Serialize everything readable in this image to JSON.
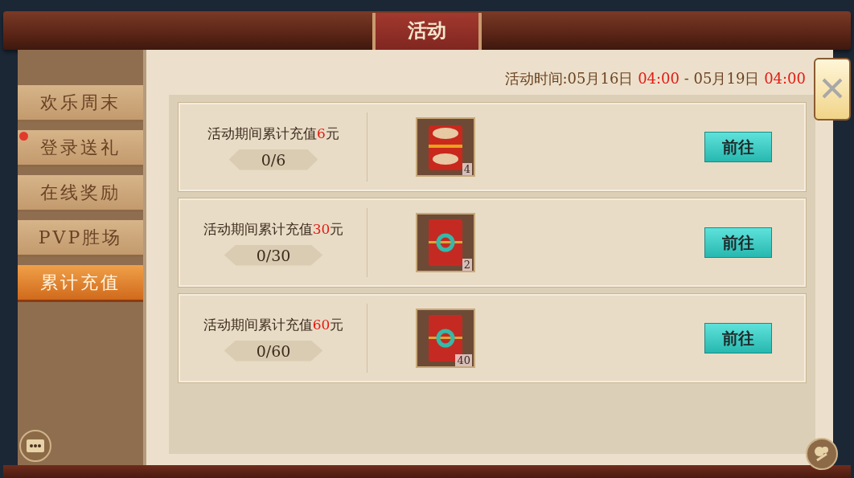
{
  "window": {
    "title": "活动"
  },
  "event_time": {
    "label": "活动时间:",
    "start_date": "05月16日",
    "start_time": "04:00",
    "separator": "-",
    "end_date": "05月19日",
    "end_time": "04:00"
  },
  "sidebar": {
    "items": [
      {
        "label": "欢乐周末",
        "selected": false,
        "badge": false
      },
      {
        "label": "登录送礼",
        "selected": false,
        "badge": true
      },
      {
        "label": "在线奖励",
        "selected": false,
        "badge": false
      },
      {
        "label": "PVP胜场",
        "selected": false,
        "badge": false
      },
      {
        "label": "累计充值",
        "selected": true,
        "badge": false
      }
    ]
  },
  "tasks": [
    {
      "prefix": "活动期间累计充值",
      "amount": "6",
      "suffix": "元",
      "progress": "0/6",
      "reward": {
        "kind": "pouch",
        "count": "4"
      },
      "button": "前往"
    },
    {
      "prefix": "活动期间累计充值",
      "amount": "30",
      "suffix": "元",
      "progress": "0/30",
      "reward": {
        "kind": "jade",
        "count": "2"
      },
      "button": "前往"
    },
    {
      "prefix": "活动期间累计充值",
      "amount": "60",
      "suffix": "元",
      "progress": "0/60",
      "reward": {
        "kind": "jade",
        "count": "40"
      },
      "button": "前往"
    }
  ]
}
